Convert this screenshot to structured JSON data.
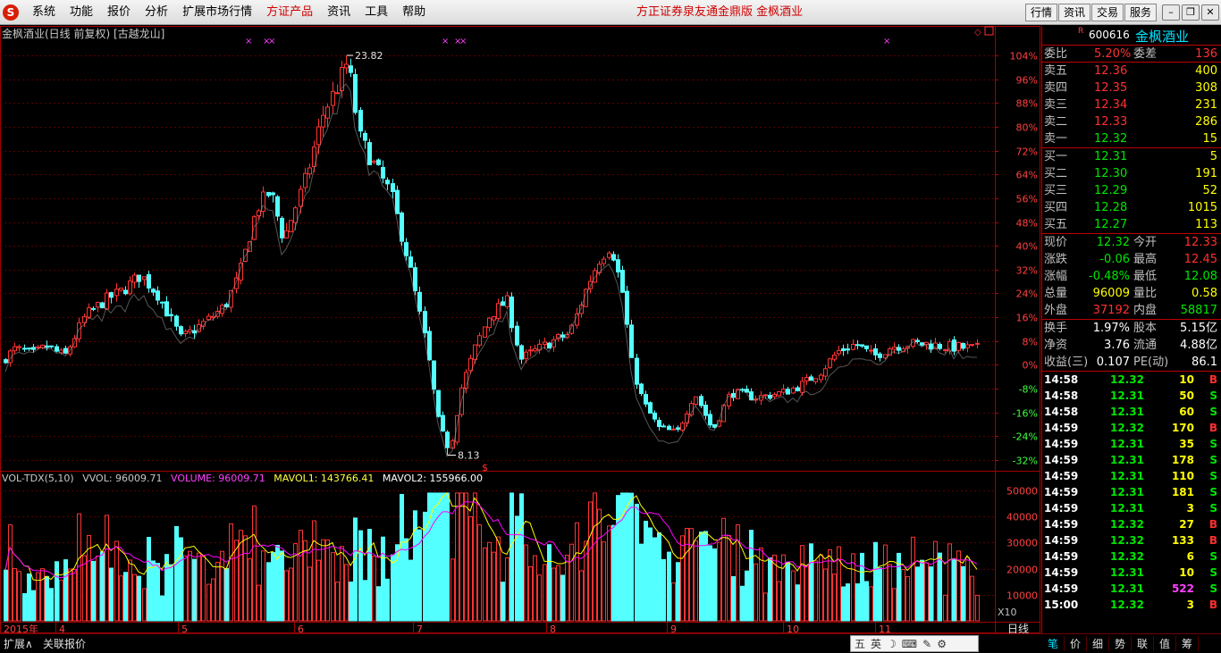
{
  "menu": {
    "items": [
      "系统",
      "功能",
      "报价",
      "分析",
      "扩展市场行情",
      "方证产品",
      "资讯",
      "工具",
      "帮助"
    ],
    "active_index": 5,
    "center_title": "方正证券泉友通金鼎版  金枫酒业",
    "right_buttons": [
      "行情",
      "资讯",
      "交易",
      "服务"
    ]
  },
  "chart": {
    "title": "金枫酒业(日线 前复权) [古越龙山]",
    "vol_title": {
      "name": "VOL-TDX(5,10)",
      "vvol": "VVOL: 96009.71",
      "volume": "VOLUME: 96009.71",
      "mavol1": "MAVOL1: 143766.41",
      "mavol2": "MAVOL2: 155966.00"
    },
    "multiplier": "X10",
    "period_label": "日线",
    "high_label": "23.82",
    "low_label": "8.13"
  },
  "chart_data": {
    "type": "candlestick",
    "price_axis_pct": [
      "104%",
      "96%",
      "88%",
      "80%",
      "72%",
      "64%",
      "56%",
      "48%",
      "40%",
      "32%",
      "24%",
      "16%",
      "8%",
      "0%",
      "-8%",
      "-16%",
      "-24%",
      "-32%"
    ],
    "volume_axis": [
      "50000",
      "40000",
      "30000",
      "20000",
      "10000"
    ],
    "x_labels": [
      "2015年",
      "4",
      "5",
      "6",
      "7",
      "8",
      "9",
      "10",
      "11"
    ],
    "high": 23.82,
    "low": 8.13,
    "last_close": 12.32,
    "colors": {
      "up": "#ff3333",
      "down": "#54ffff",
      "ma1": "#ffff00",
      "ma2": "#ff00ff"
    }
  },
  "quote": {
    "code": "600616",
    "name": "金枫酒业",
    "r_mark": "R",
    "weibi": {
      "label": "委比",
      "value": "5.20%",
      "label2": "委差",
      "value2": "136"
    },
    "sell": [
      {
        "label": "卖五",
        "price": "12.36",
        "vol": "400"
      },
      {
        "label": "卖四",
        "price": "12.35",
        "vol": "308"
      },
      {
        "label": "卖三",
        "price": "12.34",
        "vol": "231"
      },
      {
        "label": "卖二",
        "price": "12.33",
        "vol": "286"
      },
      {
        "label": "卖一",
        "price": "12.32",
        "vol": "15"
      }
    ],
    "buy": [
      {
        "label": "买一",
        "price": "12.31",
        "vol": "5"
      },
      {
        "label": "买二",
        "price": "12.30",
        "vol": "191"
      },
      {
        "label": "买三",
        "price": "12.29",
        "vol": "52"
      },
      {
        "label": "买四",
        "price": "12.28",
        "vol": "1015"
      },
      {
        "label": "买五",
        "price": "12.27",
        "vol": "113"
      }
    ],
    "stats1": [
      {
        "l1": "现价",
        "v1": "12.32",
        "c1": "dn",
        "l2": "今开",
        "v2": "12.33",
        "c2": "up"
      },
      {
        "l1": "涨跌",
        "v1": "-0.06",
        "c1": "dn",
        "l2": "最高",
        "v2": "12.45",
        "c2": "up"
      },
      {
        "l1": "涨幅",
        "v1": "-0.48%",
        "c1": "dn",
        "l2": "最低",
        "v2": "12.08",
        "c2": "dn"
      },
      {
        "l1": "总量",
        "v1": "96009",
        "c1": "yl",
        "l2": "量比",
        "v2": "0.58",
        "c2": "yl"
      },
      {
        "l1": "外盘",
        "v1": "37192",
        "c1": "up",
        "l2": "内盘",
        "v2": "58817",
        "c2": "dn"
      }
    ],
    "stats2": [
      {
        "l1": "换手",
        "v1": "1.97%",
        "l2": "股本",
        "v2": "5.15亿"
      },
      {
        "l1": "净资",
        "v1": "3.76",
        "l2": "流通",
        "v2": "4.88亿"
      },
      {
        "l1": "收益(三)",
        "v1": "0.107",
        "l2": "PE(动)",
        "v2": "86.1"
      }
    ],
    "ticks": [
      {
        "t": "14:58",
        "p": "12.32",
        "v": "10",
        "s": "B"
      },
      {
        "t": "14:58",
        "p": "12.31",
        "v": "50",
        "s": "S"
      },
      {
        "t": "14:58",
        "p": "12.31",
        "v": "60",
        "s": "S"
      },
      {
        "t": "14:59",
        "p": "12.32",
        "v": "170",
        "s": "B"
      },
      {
        "t": "14:59",
        "p": "12.31",
        "v": "35",
        "s": "S"
      },
      {
        "t": "14:59",
        "p": "12.31",
        "v": "178",
        "s": "S"
      },
      {
        "t": "14:59",
        "p": "12.31",
        "v": "110",
        "s": "S"
      },
      {
        "t": "14:59",
        "p": "12.31",
        "v": "181",
        "s": "S"
      },
      {
        "t": "14:59",
        "p": "12.31",
        "v": "3",
        "s": "S"
      },
      {
        "t": "14:59",
        "p": "12.32",
        "v": "27",
        "s": "B"
      },
      {
        "t": "14:59",
        "p": "12.32",
        "v": "133",
        "s": "B"
      },
      {
        "t": "14:59",
        "p": "12.32",
        "v": "6",
        "s": "S"
      },
      {
        "t": "14:59",
        "p": "12.31",
        "v": "10",
        "s": "S"
      },
      {
        "t": "14:59",
        "p": "12.31",
        "v": "522",
        "s": "S"
      },
      {
        "t": "15:00",
        "p": "12.32",
        "v": "3",
        "s": "B"
      }
    ]
  },
  "status": {
    "left1": "扩展∧",
    "left2": "关联报价",
    "ime": [
      "五",
      "英",
      "☽",
      "⌨",
      "✎",
      "⚙"
    ],
    "panel_tabs": [
      "笔",
      "价",
      "细",
      "势",
      "联",
      "值",
      "筹"
    ],
    "panel_tab_active": 0
  }
}
